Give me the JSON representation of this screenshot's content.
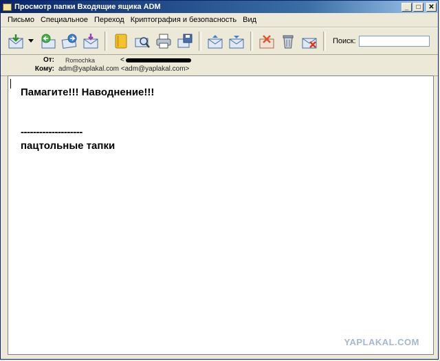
{
  "window": {
    "title": "Просмотр папки Входящие ящика ADM"
  },
  "title_buttons": {
    "minimize": "_",
    "maximize": "□",
    "close": "✕"
  },
  "menu": [
    "Письмо",
    "Специальное",
    "Переход",
    "Криптография и безопасность",
    "Вид"
  ],
  "toolbar": {
    "icons": [
      "get-mail-icon",
      "dropdown-arrow-icon",
      "reply-icon",
      "forward-icon",
      "compose-icon",
      "address-book-icon",
      "find-icon",
      "print-icon",
      "save-icon",
      "up-icon",
      "down-icon",
      "mark-icon",
      "delete-icon",
      "junk-icon"
    ],
    "search_label": "Поиск:",
    "search_value": ""
  },
  "headers": {
    "from_label": "От:",
    "from_value": "Romochka",
    "from_bracket": "<",
    "to_label": "Кому:",
    "to_value": "adm@yaplakal.com <adm@yaplakal.com>"
  },
  "message": {
    "line1": "Памагите!!! Наводнение!!!",
    "line2": "--------------------",
    "line3": "пацтольные тапки"
  },
  "watermark": "YAPLAKAL.COM"
}
